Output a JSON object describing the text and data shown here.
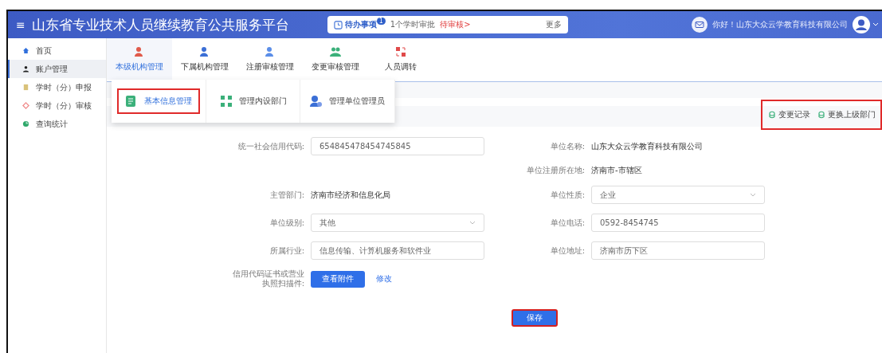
{
  "header": {
    "menu_glyph": "≡",
    "title": "山东省专业技术人员继续教育公共服务平台",
    "todo": {
      "label": "待办事项",
      "badge": "1",
      "text": "1个学时审批",
      "status": "待审核>",
      "more": "更多"
    },
    "greeting": "你好！山东大众云学教育科技有限公司"
  },
  "sidebar": {
    "items": [
      {
        "label": "首页",
        "selected": false
      },
      {
        "label": "账户管理",
        "selected": true
      },
      {
        "label": "学时（分）申报",
        "selected": false
      },
      {
        "label": "学时（分）审核",
        "selected": false
      },
      {
        "label": "查询统计",
        "selected": false
      }
    ]
  },
  "tabs": [
    {
      "label": "本级机构管理",
      "selected": true
    },
    {
      "label": "下属机构管理",
      "selected": false
    },
    {
      "label": "注册审核管理",
      "selected": false
    },
    {
      "label": "变更审核管理",
      "selected": false
    },
    {
      "label": "人员调转",
      "selected": false
    }
  ],
  "submenu": [
    {
      "label": "基本信息管理",
      "selected": true,
      "highlighted": true
    },
    {
      "label": "管理内设部门",
      "selected": false,
      "highlighted": false
    },
    {
      "label": "管理单位管理员",
      "selected": false,
      "highlighted": false
    }
  ],
  "actions": {
    "highlighted": true,
    "items": [
      "变更记录",
      "更换上级部门"
    ]
  },
  "form": {
    "rows": [
      {
        "left": {
          "label": "统一社会信用代码:",
          "kind": "input",
          "value": "654845478454745845"
        },
        "right": {
          "label": "单位名称:",
          "kind": "text",
          "value": "山东大众云学教育科技有限公司"
        }
      },
      {
        "right": {
          "label": "单位注册所在地:",
          "kind": "text",
          "value": "济南市-市辖区"
        }
      },
      {
        "left": {
          "label": "主管部门:",
          "kind": "text",
          "value": "济南市经济和信息化局"
        },
        "right": {
          "label": "单位性质:",
          "kind": "select",
          "value": "企业"
        }
      },
      {
        "left": {
          "label": "单位级别:",
          "kind": "select",
          "value": "其他"
        },
        "right": {
          "label": "单位电话:",
          "kind": "input",
          "value": "0592-8454745"
        }
      },
      {
        "left": {
          "label": "所属行业:",
          "kind": "input",
          "value": "信息传输、计算机服务和软件业"
        },
        "right": {
          "label": "单位地址:",
          "kind": "input",
          "value": "济南市历下区"
        }
      },
      {
        "left": {
          "label": "信用代码证书或营业执照扫描件:",
          "kind": "attachment",
          "value": "查看附件",
          "link": "修改"
        }
      }
    ],
    "save": {
      "label": "保存",
      "highlighted": true
    }
  }
}
